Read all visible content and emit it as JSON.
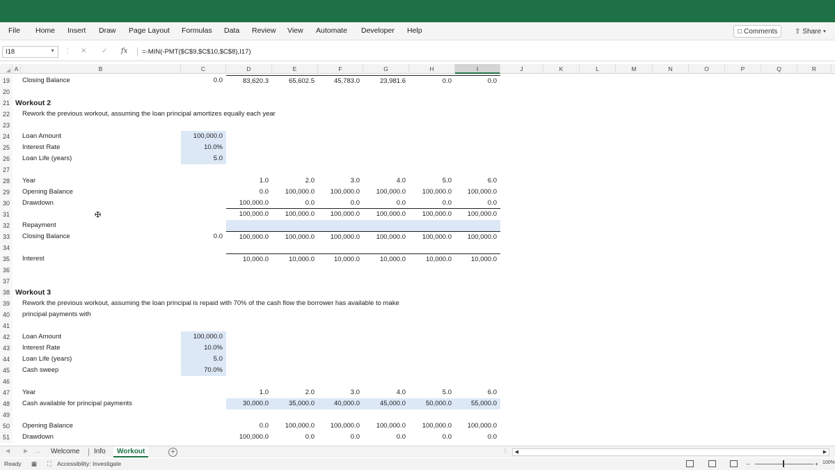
{
  "menu": {
    "items": [
      "File",
      "Home",
      "Insert",
      "Draw",
      "Page Layout",
      "Formulas",
      "Data",
      "Review",
      "View",
      "Automate",
      "Developer",
      "Help"
    ],
    "comments_label": "Comments",
    "share_label": "Share"
  },
  "formula_bar": {
    "name_box": "I18",
    "fx": "fx",
    "formula": "=-MIN(-PMT($C$9,$C$10,$C$8),I17)"
  },
  "columns": [
    "A",
    "B",
    "C",
    "D",
    "E",
    "F",
    "G",
    "H",
    "I",
    "J",
    "K",
    "L",
    "M",
    "N",
    "O",
    "P",
    "Q",
    "R"
  ],
  "rows": [
    "19",
    "20",
    "21",
    "22",
    "23",
    "24",
    "25",
    "26",
    "27",
    "28",
    "29",
    "30",
    "31",
    "32",
    "33",
    "34",
    "35",
    "36",
    "37",
    "38",
    "39",
    "40",
    "41",
    "42",
    "43",
    "44",
    "45",
    "46",
    "47",
    "48",
    "49",
    "50",
    "51"
  ],
  "sheet": {
    "r19": {
      "label": "Closing Balance",
      "c": "0.0",
      "vals": [
        "83,620.3",
        "65,602.5",
        "45,783.0",
        "23,981.6",
        "0.0",
        "0.0"
      ]
    },
    "workout2": {
      "title": "Workout 2",
      "desc": "Rework the previous workout, assuming the loan principal amortizes equally each year",
      "loan_amount_label": "Loan Amount",
      "loan_amount": "100,000.0",
      "interest_rate_label": "Interest Rate",
      "interest_rate": "10.0%",
      "loan_life_label": "Loan Life (years)",
      "loan_life": "5.0",
      "year_label": "Year",
      "years": [
        "1.0",
        "2.0",
        "3.0",
        "4.0",
        "5.0",
        "6.0"
      ],
      "opening_label": "Opening Balance",
      "opening": [
        "0.0",
        "100,000.0",
        "100,000.0",
        "100,000.0",
        "100,000.0",
        "100,000.0"
      ],
      "drawdown_label": "Drawdown",
      "drawdown": [
        "100,000.0",
        "0.0",
        "0.0",
        "0.0",
        "0.0",
        "0.0"
      ],
      "subtotal": [
        "100,000.0",
        "100,000.0",
        "100,000.0",
        "100,000.0",
        "100,000.0",
        "100,000.0"
      ],
      "repayment_label": "Repayment",
      "closing_label": "Closing Balance",
      "closing_c": "0.0",
      "closing": [
        "100,000.0",
        "100,000.0",
        "100,000.0",
        "100,000.0",
        "100,000.0",
        "100,000.0"
      ],
      "interest_label": "Interest",
      "interest": [
        "10,000.0",
        "10,000.0",
        "10,000.0",
        "10,000.0",
        "10,000.0",
        "10,000.0"
      ]
    },
    "workout3": {
      "title": "Workout 3",
      "desc1": "Rework the previous workout, assuming the loan principal is repaid with 70% of the cash flow the borrower has available to make",
      "desc2": "principal payments with",
      "loan_amount_label": "Loan Amount",
      "loan_amount": "100,000.0",
      "interest_rate_label": "Interest Rate",
      "interest_rate": "10.0%",
      "loan_life_label": "Loan Life (years)",
      "loan_life": "5.0",
      "cash_sweep_label": "Cash sweep",
      "cash_sweep": "70.0%",
      "year_label": "Year",
      "years": [
        "1.0",
        "2.0",
        "3.0",
        "4.0",
        "5.0",
        "6.0"
      ],
      "cash_label": "Cash available for principal payments",
      "cash": [
        "30,000.0",
        "35,000.0",
        "40,000.0",
        "45,000.0",
        "50,000.0",
        "55,000.0"
      ],
      "opening_label": "Opening Balance",
      "opening": [
        "0.0",
        "100,000.0",
        "100,000.0",
        "100,000.0",
        "100,000.0",
        "100,000.0"
      ],
      "drawdown_label": "Drawdown",
      "drawdown": [
        "100,000.0",
        "0.0",
        "0.0",
        "0.0",
        "0.0",
        "0.0"
      ]
    }
  },
  "tabs": [
    "Welcome",
    "Info",
    "Workout"
  ],
  "active_tab": "Workout",
  "status": {
    "ready": "Ready",
    "accessibility": "Accessibility: Investigate",
    "zoom": "100%"
  },
  "colors": {
    "excel_green": "#1e7145",
    "input_fill": "#dde8f7"
  }
}
